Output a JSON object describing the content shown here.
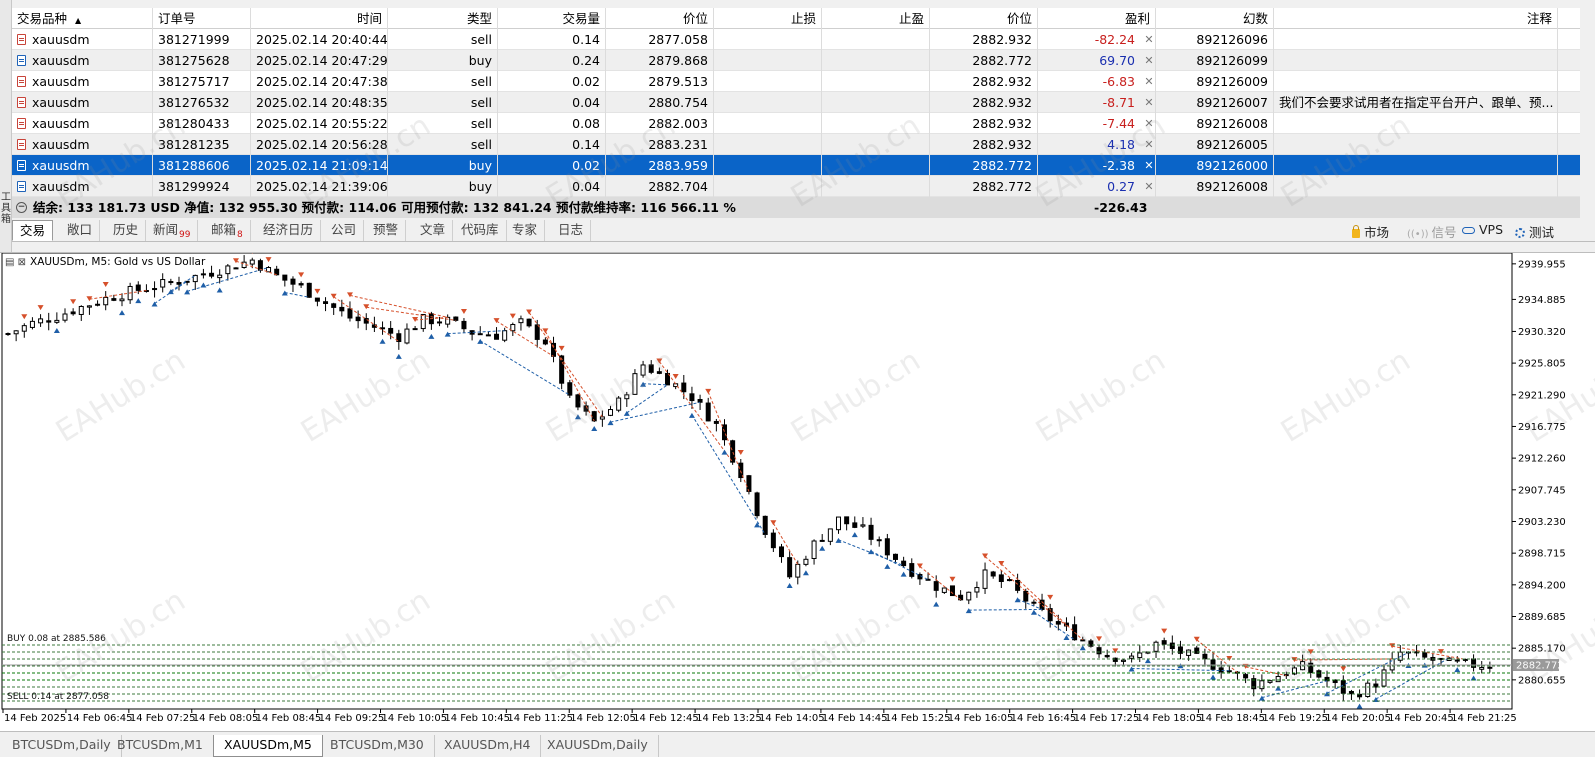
{
  "table": {
    "headers": [
      "交易品种",
      "订单号",
      "时间",
      "类型",
      "交易量",
      "价位",
      "止损",
      "止盈",
      "价位",
      "盈利",
      "幻数",
      "注释"
    ],
    "rows": [
      {
        "symbol": "xauusdm",
        "ticket": "381271999",
        "time": "2025.02.14 20:40:44",
        "type": "sell",
        "volume": "0.14",
        "price": "2877.058",
        "sl": "",
        "tp": "",
        "cur": "2882.932",
        "profit": "-82.24",
        "magic": "892126096",
        "comment": ""
      },
      {
        "symbol": "xauusdm",
        "ticket": "381275628",
        "time": "2025.02.14 20:47:29",
        "type": "buy",
        "volume": "0.24",
        "price": "2879.868",
        "sl": "",
        "tp": "",
        "cur": "2882.772",
        "profit": "69.70",
        "magic": "892126099",
        "comment": ""
      },
      {
        "symbol": "xauusdm",
        "ticket": "381275717",
        "time": "2025.02.14 20:47:38",
        "type": "sell",
        "volume": "0.02",
        "price": "2879.513",
        "sl": "",
        "tp": "",
        "cur": "2882.932",
        "profit": "-6.83",
        "magic": "892126009",
        "comment": ""
      },
      {
        "symbol": "xauusdm",
        "ticket": "381276532",
        "time": "2025.02.14 20:48:35",
        "type": "sell",
        "volume": "0.04",
        "price": "2880.754",
        "sl": "",
        "tp": "",
        "cur": "2882.932",
        "profit": "-8.71",
        "magic": "892126007",
        "comment": "我们不会要求试用者在指定平台开户、跟单、预..."
      },
      {
        "symbol": "xauusdm",
        "ticket": "381280433",
        "time": "2025.02.14 20:55:22",
        "type": "sell",
        "volume": "0.08",
        "price": "2882.003",
        "sl": "",
        "tp": "",
        "cur": "2882.932",
        "profit": "-7.44",
        "magic": "892126008",
        "comment": ""
      },
      {
        "symbol": "xauusdm",
        "ticket": "381281235",
        "time": "2025.02.14 20:56:28",
        "type": "sell",
        "volume": "0.14",
        "price": "2883.231",
        "sl": "",
        "tp": "",
        "cur": "2882.932",
        "profit": "4.18",
        "magic": "892126005",
        "comment": ""
      },
      {
        "symbol": "xauusdm",
        "ticket": "381288606",
        "time": "2025.02.14 21:09:14",
        "type": "buy",
        "volume": "0.02",
        "price": "2883.959",
        "sl": "",
        "tp": "",
        "cur": "2882.772",
        "profit": "-2.38",
        "magic": "892126000",
        "comment": ""
      },
      {
        "symbol": "xauusdm",
        "ticket": "381299924",
        "time": "2025.02.14 21:39:06",
        "type": "buy",
        "volume": "0.04",
        "price": "2882.704",
        "sl": "",
        "tp": "",
        "cur": "2882.772",
        "profit": "0.27",
        "magic": "892126008",
        "comment": ""
      }
    ],
    "selected_row": 6,
    "close_glyph": "✕",
    "sort_glyph": "▲"
  },
  "summary": {
    "text": "结余: 133 181.73 USD  净值: 132 955.30  预付款: 114.06  可用预付款: 132 841.24  预付款维持率: 116 566.11 %",
    "total_profit": "-226.43",
    "collapse_glyph": "−"
  },
  "toolbox_label": "工具箱",
  "terminal_tabs": [
    {
      "label": "交易",
      "badge": ""
    },
    {
      "label": "敞口",
      "badge": ""
    },
    {
      "label": "历史",
      "badge": ""
    },
    {
      "label": "新闻",
      "badge": "99"
    },
    {
      "label": "邮箱",
      "badge": "8"
    },
    {
      "label": "经济日历",
      "badge": ""
    },
    {
      "label": "公司",
      "badge": ""
    },
    {
      "label": "预警",
      "badge": ""
    },
    {
      "label": "文章",
      "badge": ""
    },
    {
      "label": "代码库",
      "badge": ""
    },
    {
      "label": "专家",
      "badge": ""
    },
    {
      "label": "日志",
      "badge": ""
    }
  ],
  "right_tools": {
    "market": "市场",
    "signals": "信号",
    "vps": "VPS",
    "tester": "测试"
  },
  "chart": {
    "title": "XAUUSDm, M5:  Gold vs US Dollar",
    "current_price": "2882.772"
  },
  "order_labels": [
    "BUY 0.08 at 2885.586",
    "SELL 0.14 at 2877.058"
  ],
  "bottom_tabs": [
    "BTCUSDm,Daily",
    "BTCUSDm,M1",
    "XAUUSDm,M5",
    "BTCUSDm,M30",
    "XAUUSDm,H4",
    "XAUUSDm,Daily"
  ],
  "bottom_active": 2,
  "watermark": "EAHub.cn",
  "chart_data": {
    "type": "candlestick",
    "symbol": "XAUUSDm",
    "timeframe": "M5",
    "ylim": [
      2876.5,
      2941.5
    ],
    "y_ticks": [
      "2939.955",
      "2934.885",
      "2930.320",
      "2925.805",
      "2921.290",
      "2916.775",
      "2912.260",
      "2907.745",
      "2903.230",
      "2898.715",
      "2894.200",
      "2889.685",
      "2885.170",
      "2880.655"
    ],
    "x_ticks": [
      "14 Feb 2025",
      "14 Feb 06:45",
      "14 Feb 07:25",
      "14 Feb 08:05",
      "14 Feb 08:45",
      "14 Feb 09:25",
      "14 Feb 10:05",
      "14 Feb 10:45",
      "14 Feb 11:25",
      "14 Feb 12:05",
      "14 Feb 12:45",
      "14 Feb 13:25",
      "14 Feb 14:05",
      "14 Feb 14:45",
      "14 Feb 15:25",
      "14 Feb 16:05",
      "14 Feb 16:45",
      "14 Feb 17:25",
      "14 Feb 18:05",
      "14 Feb 18:45",
      "14 Feb 19:25",
      "14 Feb 20:05",
      "14 Feb 20:45",
      "14 Feb 21:25"
    ],
    "close_series": [
      2930.0,
      2931.5,
      2932.5,
      2933.8,
      2935.0,
      2936.0,
      2936.8,
      2937.5,
      2938.5,
      2939.4,
      2940.5,
      2938.2,
      2936.6,
      2934.4,
      2932.3,
      2931.0,
      2929.6,
      2932.0,
      2931.8,
      2930.2,
      2929.8,
      2931.5,
      2928.9,
      2920.5,
      2917.4,
      2920.2,
      2925.6,
      2923.5,
      2921.0,
      2917.0,
      2910.2,
      2902.0,
      2895.4,
      2900.0,
      2903.5,
      2902.0,
      2899.0,
      2896.2,
      2894.0,
      2892.5,
      2895.6,
      2894.2,
      2891.0,
      2888.5,
      2886.4,
      2884.2,
      2883.5,
      2885.8,
      2884.6,
      2883.2,
      2882.0,
      2880.0,
      2881.3,
      2882.5,
      2880.5,
      2878.4,
      2880.2,
      2884.5,
      2883.7,
      2883.0,
      2882.77
    ],
    "current_price": 2882.772
  }
}
